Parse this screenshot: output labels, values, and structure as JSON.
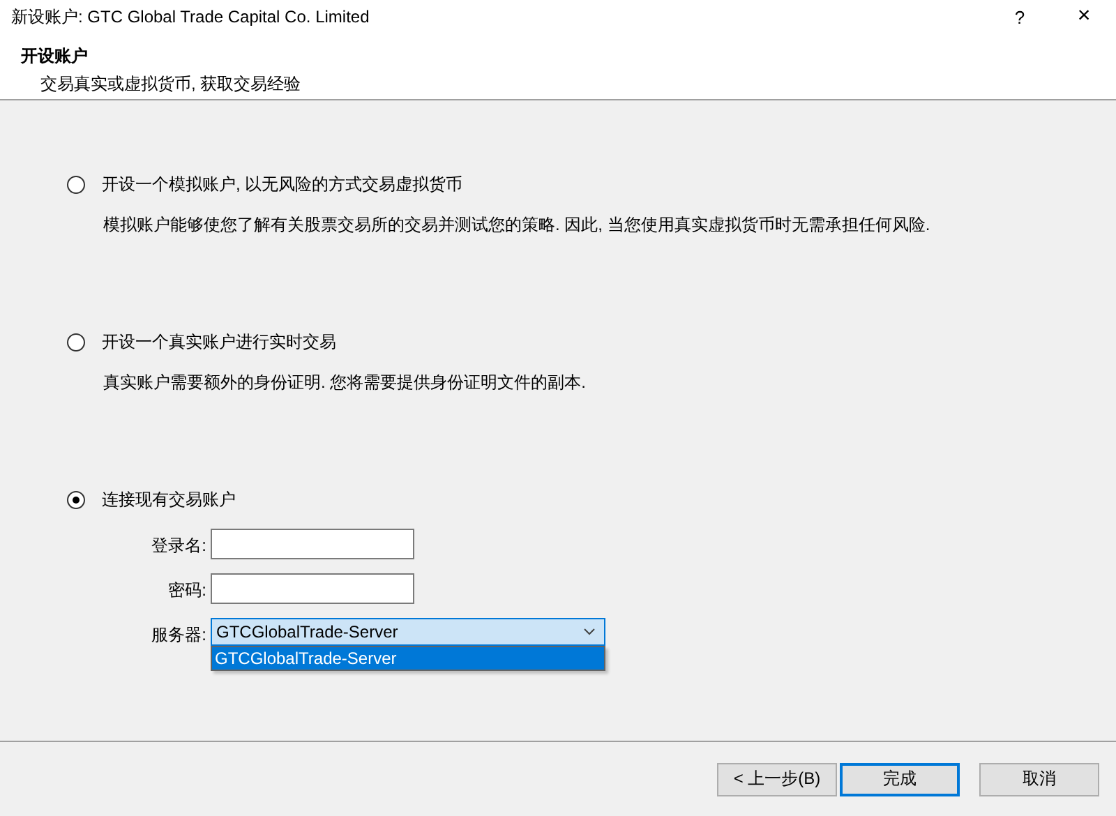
{
  "window": {
    "title": "新设账户: GTC Global Trade Capital Co. Limited",
    "help": "?",
    "close": "×"
  },
  "header": {
    "title": "开设账户",
    "subtitle": "交易真实或虚拟货币, 获取交易经验"
  },
  "options": [
    {
      "label": "开设一个模拟账户, 以无风险的方式交易虚拟货币",
      "description": "模拟账户能够使您了解有关股票交易所的交易并测试您的策略. 因此, 当您使用真实虚拟货币时无需承担任何风险.",
      "selected": false
    },
    {
      "label": "开设一个真实账户进行实时交易",
      "description": "真实账户需要额外的身份证明. 您将需要提供身份证明文件的副本.",
      "selected": false
    },
    {
      "label": "连接现有交易账户",
      "selected": true
    }
  ],
  "fields": [
    {
      "kind": "text",
      "label": "登录名:"
    },
    {
      "kind": "text",
      "label": "密码:"
    },
    {
      "kind": "combo",
      "label": "服务器:",
      "value": "GTCGlobalTrade-Server",
      "expanded": true,
      "items": [
        {
          "label": "GTCGlobalTrade-Server",
          "selected": true
        }
      ]
    }
  ],
  "buttons": [
    {
      "label": "< 上一步(B)",
      "default": false
    },
    {
      "label": "完成",
      "default": true
    },
    {
      "label": "取消",
      "default": false
    }
  ]
}
